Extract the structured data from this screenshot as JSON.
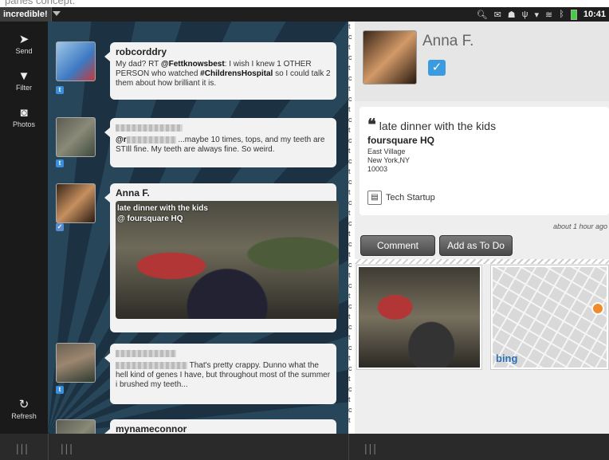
{
  "caption": "panes concept.",
  "statusbar": {
    "app_name": "incredible!",
    "time": "10:41",
    "icons": [
      "search-icon",
      "mail-icon",
      "notification-icon",
      "usb-icon",
      "dropdown-icon",
      "wifi-icon",
      "bluetooth-icon",
      "battery-icon"
    ]
  },
  "sidebar": {
    "send": "Send",
    "filter": "Filter",
    "photos": "Photos",
    "refresh": "Refresh"
  },
  "feed": {
    "items": [
      {
        "name": "robcorddry",
        "t1": "My dad? RT ",
        "m1": "@Fettknowsbest",
        "t2": ": I wish I knew 1 OTHER PERSON who watched ",
        "m2": "#ChildrensHospital",
        "t3": " so I could talk 2 them about how brilliant it is.",
        "source": "twitter"
      },
      {
        "t1": "@r",
        "t2": " ...maybe 10 times, tops, and my teeth are STIll fine. My teeth are always fine. So weird.",
        "source": "twitter"
      },
      {
        "name": "Anna F.",
        "cap1": "late dinner with the kids",
        "cap2": "@ foursquare HQ",
        "source": "foursquare"
      },
      {
        "t1": " That's pretty crappy. Dunno what the hell kind of genes I have, but throughout most of the summer i brushed my teeth...",
        "source": "twitter"
      },
      {
        "name": "mynameconnor"
      }
    ]
  },
  "detail": {
    "user_name": "Anna F.",
    "quote": "late dinner with the kids",
    "venue": "foursquare HQ",
    "address": [
      "East Village",
      "New York,NY",
      "10003"
    ],
    "category": "Tech Startup",
    "time_ago": "about 1 hour ago",
    "comment_button": "Comment",
    "todo_button": "Add as To Do",
    "map_logo": "bing"
  },
  "colors": {
    "feed_bg": "#213848",
    "accent_blue": "#3a9be0",
    "map_pin": "#f08a2c"
  }
}
